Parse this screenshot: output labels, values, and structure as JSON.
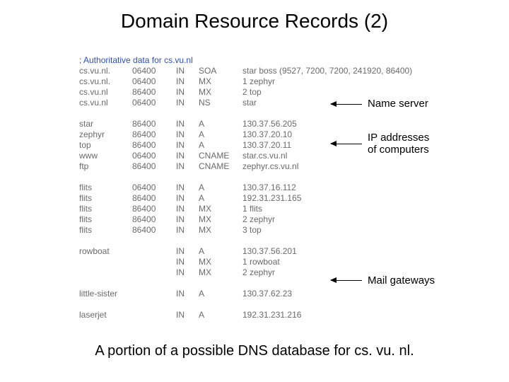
{
  "title": "Domain Resource Records (2)",
  "comment": "; Authoritative data for cs.vu.nl",
  "records": [
    [
      "cs.vu.nl.",
      "06400",
      "IN",
      "SOA",
      "star boss (9527, 7200, 7200, 241920, 86400)"
    ],
    [
      "cs.vu.nl.",
      "06400",
      "IN",
      "MX",
      "1 zephyr"
    ],
    [
      "cs.vu.nl",
      "86400",
      "IN",
      "MX",
      "2 top"
    ],
    [
      "cs.vu.nl",
      "06400",
      "IN",
      "NS",
      "star"
    ],
    "",
    [
      "star",
      "86400",
      "IN",
      "A",
      "130.37.56.205"
    ],
    [
      "zephyr",
      "86400",
      "IN",
      "A",
      "130.37.20.10"
    ],
    [
      "top",
      "86400",
      "IN",
      "A",
      "130.37.20.11"
    ],
    [
      "www",
      "06400",
      "IN",
      "CNAME",
      "star.cs.vu.nl"
    ],
    [
      "ftp",
      "86400",
      "IN",
      "CNAME",
      "zephyr.cs.vu.nl"
    ],
    "",
    [
      "flits",
      "06400",
      "IN",
      "A",
      "130.37.16.112"
    ],
    [
      "flits",
      "86400",
      "IN",
      "A",
      "192.31.231.165"
    ],
    [
      "flits",
      "86400",
      "IN",
      "MX",
      "1 flits"
    ],
    [
      "flits",
      "86400",
      "IN",
      "MX",
      "2 zephyr"
    ],
    [
      "flits",
      "86400",
      "IN",
      "MX",
      "3 top"
    ],
    "",
    [
      "rowboat",
      "",
      "IN",
      "A",
      "130.37.56.201"
    ],
    [
      "",
      "",
      "IN",
      "MX",
      "1 rowboat"
    ],
    [
      "",
      "",
      "IN",
      "MX",
      "2 zephyr"
    ],
    "",
    [
      "little-sister",
      "",
      "IN",
      "A",
      "130.37.62.23"
    ],
    "",
    [
      "laserjet",
      "",
      "IN",
      "A",
      "192.31.231.216"
    ]
  ],
  "annotations": {
    "nameserver": "Name server",
    "ipaddresses_l1": "IP addresses",
    "ipaddresses_l2": "of computers",
    "mailgateways": "Mail gateways"
  },
  "caption": "A portion of a possible DNS database for cs. vu. nl."
}
